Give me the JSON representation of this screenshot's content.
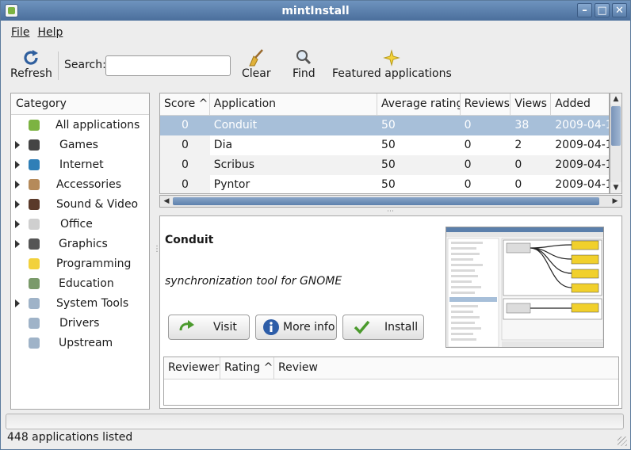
{
  "window": {
    "title": "mintInstall",
    "minimize_glyph": "–",
    "maximize_glyph": "□",
    "close_glyph": "✕"
  },
  "menu": [
    {
      "label": "File"
    },
    {
      "label": "Help"
    }
  ],
  "toolbar": {
    "refresh_label": "Refresh",
    "search_label": "Search:",
    "search_value": "",
    "clear_label": "Clear",
    "find_label": "Find",
    "featured_label": "Featured applications"
  },
  "categories": {
    "header": "Category",
    "items": [
      {
        "label": "All applications",
        "expandable": false,
        "icon": "mint-icon",
        "color": "#7cb342"
      },
      {
        "label": "Games",
        "expandable": true,
        "icon": "joystick-icon",
        "color": "#444444"
      },
      {
        "label": "Internet",
        "expandable": true,
        "icon": "globe-icon",
        "color": "#2f7fb7"
      },
      {
        "label": "Accessories",
        "expandable": true,
        "icon": "accessories-icon",
        "color": "#b58a5a"
      },
      {
        "label": "Sound & Video",
        "expandable": true,
        "icon": "film-icon",
        "color": "#5a3a2a"
      },
      {
        "label": "Office",
        "expandable": true,
        "icon": "document-icon",
        "color": "#cfcfcf"
      },
      {
        "label": "Graphics",
        "expandable": true,
        "icon": "brush-icon",
        "color": "#555555"
      },
      {
        "label": "Programming",
        "expandable": false,
        "icon": "lightbulb-icon",
        "color": "#f2d13c"
      },
      {
        "label": "Education",
        "expandable": false,
        "icon": "education-icon",
        "color": "#7a9a6a"
      },
      {
        "label": "System Tools",
        "expandable": true,
        "icon": "tools-icon",
        "color": "#9fb3c8"
      },
      {
        "label": "Drivers",
        "expandable": false,
        "icon": "tools-icon",
        "color": "#9fb3c8"
      },
      {
        "label": "Upstream",
        "expandable": false,
        "icon": "tools-icon",
        "color": "#9fb3c8"
      }
    ]
  },
  "apps": {
    "columns": {
      "score": "Score",
      "application": "Application",
      "average_rating": "Average rating",
      "reviews": "Reviews",
      "views": "Views",
      "added": "Added"
    },
    "sort_arrow": "^",
    "rows": [
      {
        "score": "0",
        "application": "Conduit",
        "average_rating": "50",
        "reviews": "0",
        "views": "38",
        "added": "2009-04-1",
        "selected": true
      },
      {
        "score": "0",
        "application": "Dia",
        "average_rating": "50",
        "reviews": "0",
        "views": "2",
        "added": "2009-04-1",
        "selected": false
      },
      {
        "score": "0",
        "application": "Scribus",
        "average_rating": "50",
        "reviews": "0",
        "views": "0",
        "added": "2009-04-1",
        "selected": false
      },
      {
        "score": "0",
        "application": "Pyntor",
        "average_rating": "50",
        "reviews": "0",
        "views": "0",
        "added": "2009-04-1",
        "selected": false
      }
    ]
  },
  "detail": {
    "name": "Conduit",
    "description": "synchronization tool for GNOME",
    "visit_label": "Visit",
    "more_info_label": "More info",
    "install_label": "Install"
  },
  "reviews": {
    "columns": {
      "reviewer": "Reviewer",
      "rating": "Rating",
      "review": "Review"
    }
  },
  "status": {
    "text": "448 applications listed"
  },
  "colors": {
    "selection": "#a7bfd9",
    "titlebar": "#5b7fab",
    "accent_green": "#4caf50"
  }
}
